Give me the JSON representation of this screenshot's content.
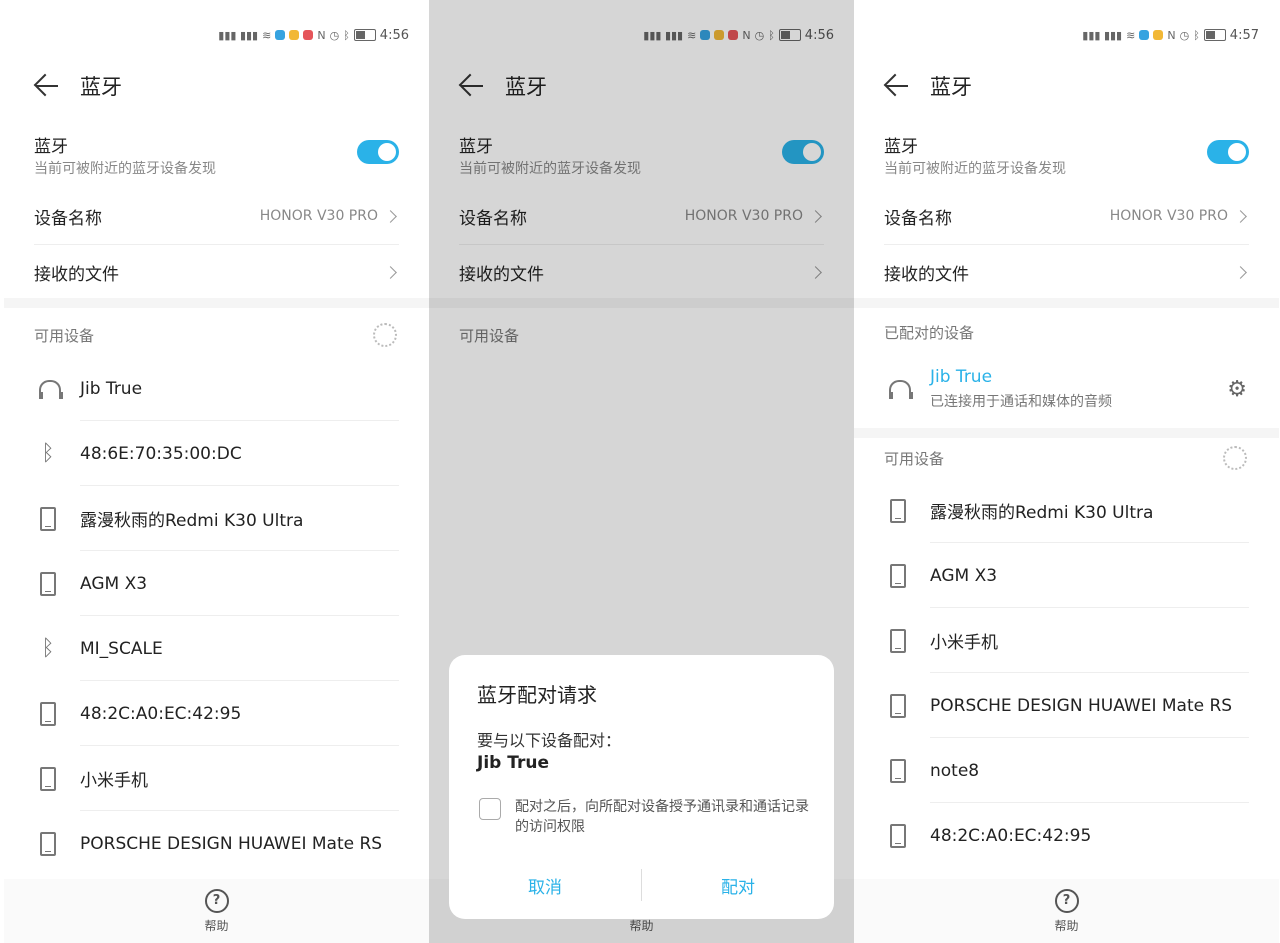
{
  "screens": [
    {
      "status_time": "4:56",
      "title": "蓝牙",
      "bluetooth_label": "蓝牙",
      "bluetooth_sub": "当前可被附近的蓝牙设备发现",
      "device_name_label": "设备名称",
      "device_name_value": "HONOR V30 PRO",
      "received_files_label": "接收的文件",
      "available_label": "可用设备",
      "available": [
        {
          "name": "Jib True",
          "icon": "headset-icon"
        },
        {
          "name": "48:6E:70:35:00:DC",
          "icon": "bluetooth-icon"
        },
        {
          "name": "露漫秋雨的Redmi K30 Ultra",
          "icon": "phone-icon"
        },
        {
          "name": "AGM X3",
          "icon": "phone-icon"
        },
        {
          "name": "MI_SCALE",
          "icon": "bluetooth-icon"
        },
        {
          "name": "48:2C:A0:EC:42:95",
          "icon": "phone-icon"
        },
        {
          "name": "小米手机",
          "icon": "phone-icon"
        },
        {
          "name": "PORSCHE DESIGN HUAWEI Mate RS",
          "icon": "phone-icon"
        }
      ],
      "help_label": "帮助"
    },
    {
      "status_time": "4:56",
      "title": "蓝牙",
      "bluetooth_label": "蓝牙",
      "bluetooth_sub": "当前可被附近的蓝牙设备发现",
      "device_name_label": "设备名称",
      "device_name_value": "HONOR V30 PRO",
      "received_files_label": "接收的文件",
      "available_label": "可用设备",
      "help_label": "帮助",
      "dialog": {
        "title": "蓝牙配对请求",
        "message": "要与以下设备配对：",
        "device": "Jib True",
        "checkbox_text": "配对之后，向所配对设备授予通讯录和通话记录的访问权限",
        "cancel": "取消",
        "confirm": "配对"
      }
    },
    {
      "status_time": "4:57",
      "title": "蓝牙",
      "bluetooth_label": "蓝牙",
      "bluetooth_sub": "当前可被附近的蓝牙设备发现",
      "device_name_label": "设备名称",
      "device_name_value": "HONOR V30 PRO",
      "received_files_label": "接收的文件",
      "paired_label": "已配对的设备",
      "paired": {
        "name": "Jib True",
        "sub": "已连接用于通话和媒体的音频"
      },
      "available_label": "可用设备",
      "available": [
        {
          "name": "露漫秋雨的Redmi K30 Ultra",
          "icon": "phone-icon"
        },
        {
          "name": "AGM X3",
          "icon": "phone-icon"
        },
        {
          "name": "小米手机",
          "icon": "phone-icon"
        },
        {
          "name": "PORSCHE DESIGN HUAWEI Mate RS",
          "icon": "phone-icon"
        },
        {
          "name": "note8",
          "icon": "phone-icon"
        },
        {
          "name": "48:2C:A0:EC:42:95",
          "icon": "phone-icon"
        }
      ],
      "help_label": "帮助"
    }
  ],
  "colors": {
    "accent": "#2ab2e8"
  }
}
